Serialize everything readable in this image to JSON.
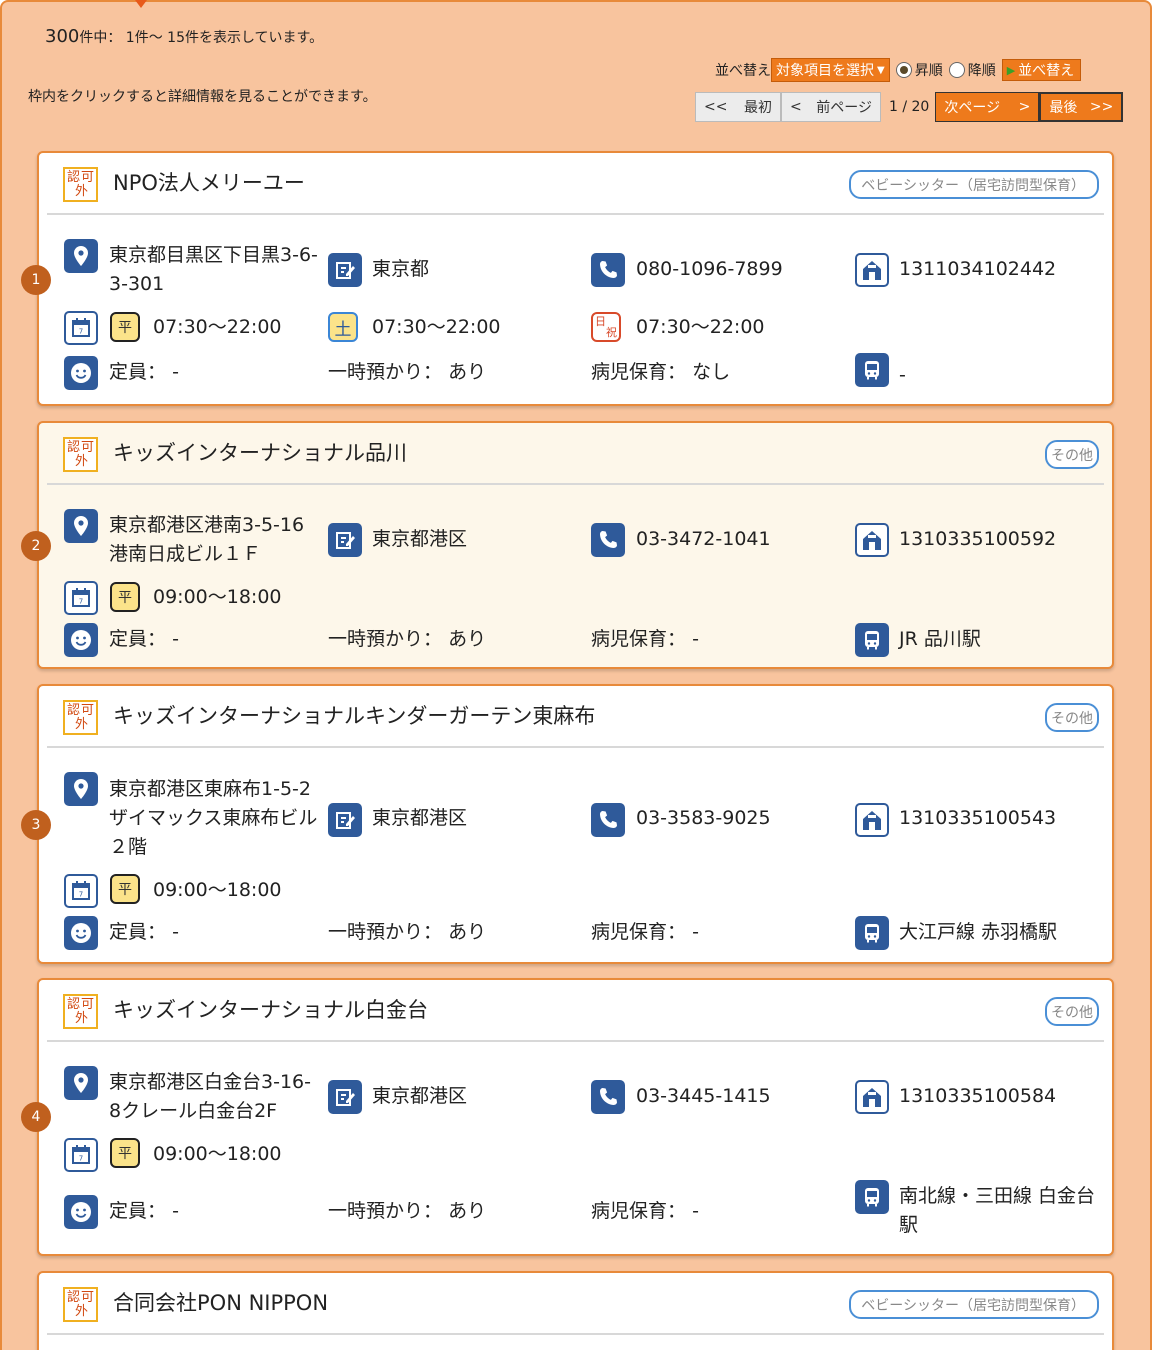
{
  "header": {
    "count_total": "300",
    "count_rest": "件中： 1件～ 15件を表示しています。",
    "hint": "枠内をクリックすると詳細情報を見ることができます。"
  },
  "sort": {
    "label": "並べ替え",
    "selected": "対象項目を選択",
    "asc": "昇順",
    "desc": "降順",
    "button": "並べ替え",
    "order": "asc"
  },
  "pager": {
    "first_arrow": "<<",
    "first_label": "最初",
    "prev_arrow": "<",
    "prev_label": "前ページ",
    "info": "1 / 20",
    "next_label": "次ページ",
    "next_arrow": ">",
    "last_label": "最後",
    "last_arrow": ">>"
  },
  "labels": {
    "capacity": "定員：",
    "temp_care": "一時預かり：",
    "sick_care": "病児保育："
  },
  "badge": {
    "char1": "認",
    "char2": "可",
    "char3": "外"
  },
  "cards": [
    {
      "no": "1",
      "name": "NPO法人メリーユー",
      "category": "ベビーシッター（居宅訪問型保育）",
      "address": "東京都目黒区下目黒3-6-3-301",
      "municipality": "東京都",
      "phone": "080-1096-7899",
      "reg_no": "1311034102442",
      "hours_weekday": "07:30～22:00",
      "hours_saturday": "07:30～22:00",
      "hours_holiday": "07:30～22:00",
      "capacity": "-",
      "temp_care": "あり",
      "sick_care": "なし",
      "station": "-"
    },
    {
      "no": "2",
      "name": "キッズインターナショナル品川",
      "category": "その他",
      "address": "東京都港区港南3-5-16 港南日成ビル１Ｆ",
      "municipality": "東京都港区",
      "phone": "03-3472-1041",
      "reg_no": "1310335100592",
      "hours_weekday": "09:00～18:00",
      "capacity": "-",
      "temp_care": "あり",
      "sick_care": "-",
      "station": "JR 品川駅"
    },
    {
      "no": "3",
      "name": "キッズインターナショナルキンダーガーテン東麻布",
      "category": "その他",
      "address": "東京都港区東麻布1-5-2 ザイマックス東麻布ビル２階",
      "municipality": "東京都港区",
      "phone": "03-3583-9025",
      "reg_no": "1310335100543",
      "hours_weekday": "09:00～18:00",
      "capacity": "-",
      "temp_care": "あり",
      "sick_care": "-",
      "station": "大江戸線 赤羽橋駅"
    },
    {
      "no": "4",
      "name": "キッズインターナショナル白金台",
      "category": "その他",
      "address": "東京都港区白金台3-16-8クレール白金台2F",
      "municipality": "東京都港区",
      "phone": "03-3445-1415",
      "reg_no": "1310335100584",
      "hours_weekday": "09:00～18:00",
      "capacity": "-",
      "temp_care": "あり",
      "sick_care": "-",
      "station": "南北線・三田線 白金台駅"
    },
    {
      "name": "合同会社PON NIPPON",
      "category": "ベビーシッター（居宅訪問型保育）"
    }
  ],
  "day_marks": {
    "weekday": "平",
    "saturday": "土",
    "holiday_top": "日",
    "holiday_bottom": "祝"
  },
  "icons": [
    "map-pin-icon",
    "edit-note-icon",
    "phone-icon",
    "registration-house-icon",
    "calendar-icon",
    "smiley-icon",
    "bus-icon"
  ],
  "colors": {
    "panel_bg": "#f8c49e",
    "accent_orange": "#ee7a1c",
    "icon_blue": "#2f5a9a",
    "number_circle": "#c0601e"
  }
}
